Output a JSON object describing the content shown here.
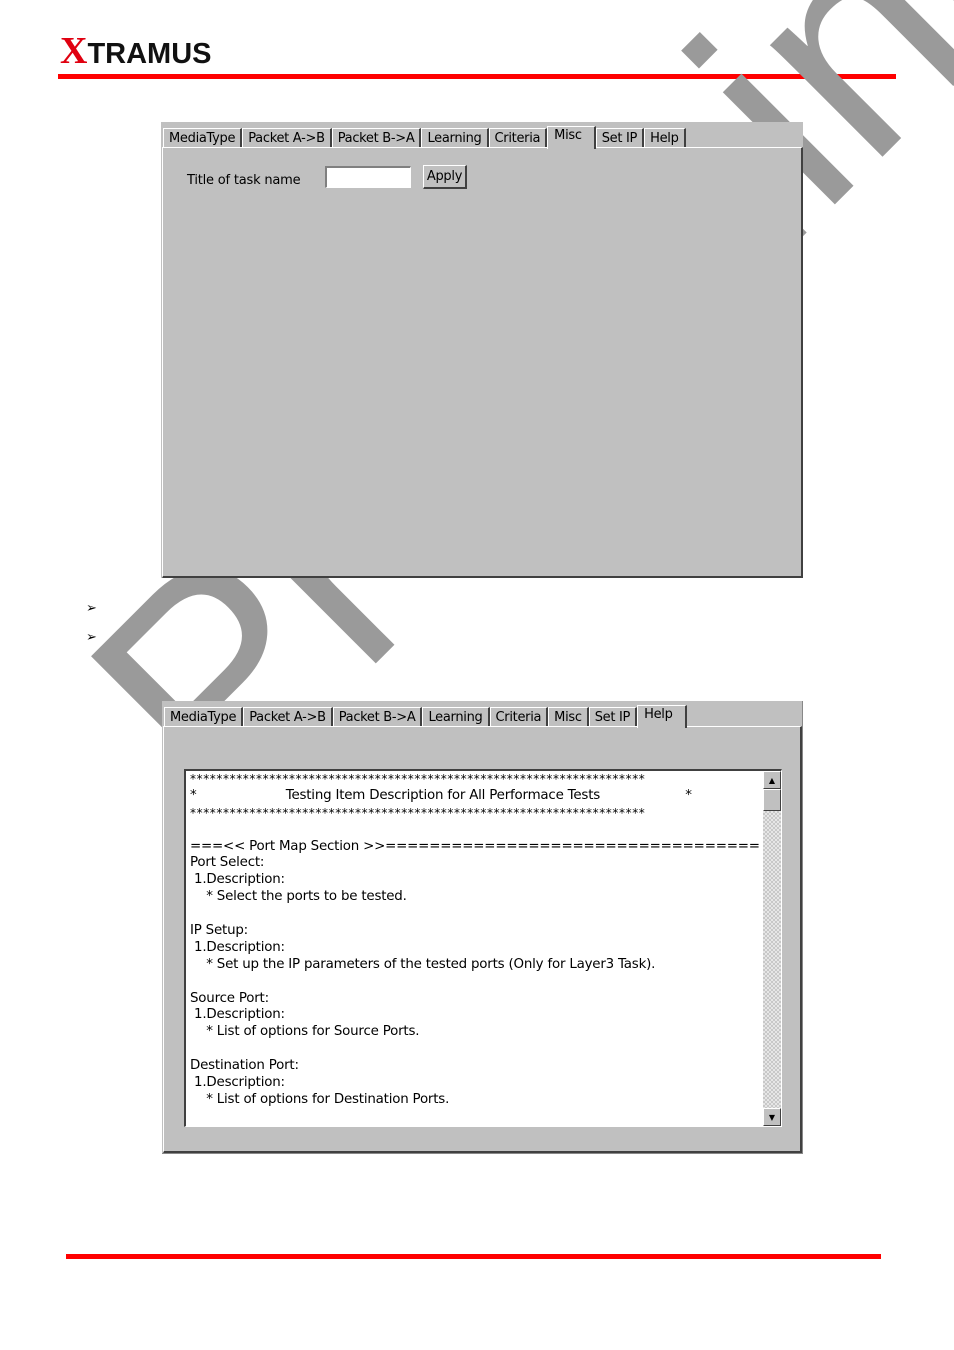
{
  "header": {
    "logo_first": "X",
    "logo_rest": "TRAMUS",
    "rule_color": "#ff0000"
  },
  "watermark": {
    "text": "Preliminary",
    "color": "#9a9a9a"
  },
  "misc_window": {
    "tabs": [
      {
        "label": "MediaType",
        "active": false
      },
      {
        "label": "Packet A->B",
        "active": false
      },
      {
        "label": "Packet B->A",
        "active": false
      },
      {
        "label": "Learning",
        "active": false
      },
      {
        "label": "Criteria",
        "active": false
      },
      {
        "label": "Misc",
        "active": true
      },
      {
        "label": "Set IP",
        "active": false
      },
      {
        "label": "Help",
        "active": false
      }
    ],
    "task_label": "Title of task name",
    "task_input_value": "",
    "apply_label": "Apply"
  },
  "bullets": [
    {
      "icon": "arrow-bullet-icon",
      "glyph": "➢",
      "text": ""
    },
    {
      "icon": "arrow-bullet-icon",
      "glyph": "➢",
      "text": ""
    }
  ],
  "help_window": {
    "tabs": [
      {
        "label": "MediaType",
        "active": false
      },
      {
        "label": "Packet A->B",
        "active": false
      },
      {
        "label": "Packet B->A",
        "active": false
      },
      {
        "label": "Learning",
        "active": false
      },
      {
        "label": "Criteria",
        "active": false
      },
      {
        "label": "Misc",
        "active": false
      },
      {
        "label": "Set IP",
        "active": false
      },
      {
        "label": "Help",
        "active": true
      }
    ],
    "help_lines": [
      "*********************************************************************",
      "*                      Testing Item Description for All Performace Tests                     *",
      "*********************************************************************",
      "",
      "===<< Port Map Section >>==================================",
      "Port Select:",
      " 1.Description:",
      "    * Select the ports to be tested.",
      "",
      "IP Setup:",
      " 1.Description:",
      "    * Set up the IP parameters of the tested ports (Only for Layer3 Task).",
      "",
      "Source Port:",
      " 1.Description:",
      "    * List of options for Source Ports.",
      "",
      "Destination Port:",
      " 1.Description:",
      "    * List of options for Destination Ports.",
      ""
    ],
    "scroll_up_glyph": "▲",
    "scroll_down_glyph": "▼"
  }
}
